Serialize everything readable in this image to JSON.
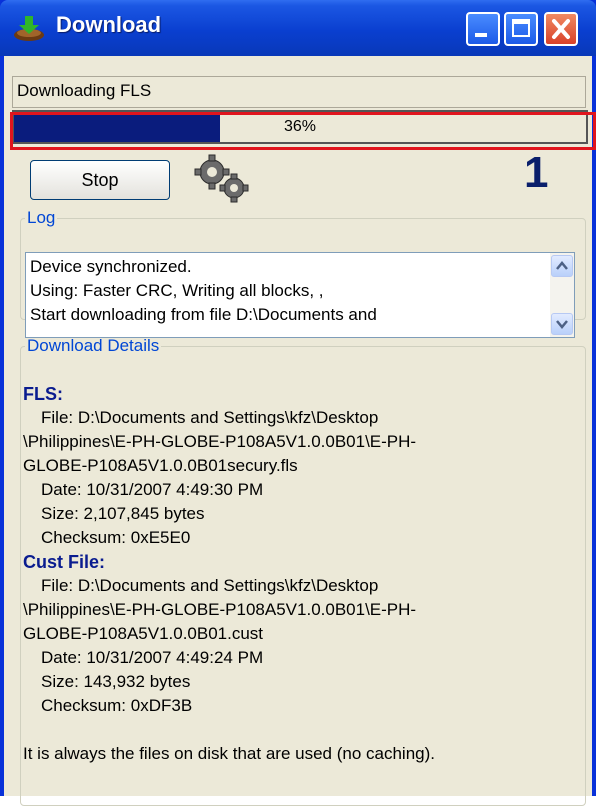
{
  "window": {
    "title": "Download"
  },
  "status_text": "Downloading FLS",
  "progress": {
    "percent": 36,
    "label": "36%"
  },
  "stop_label": "Stop",
  "step_number": "1",
  "log": {
    "legend": "Log",
    "lines": [
      "Device synchronized.",
      "Using: Faster CRC, Writing all blocks, ,",
      "Start downloading from file D:\\Documents and"
    ]
  },
  "details": {
    "legend": "Download Details",
    "fls": {
      "header": "FLS:",
      "file": "File: D:\\Documents and Settings\\kfz\\Desktop",
      "path1": "\\Philippines\\E-PH-GLOBE-P108A5V1.0.0B01\\E-PH-",
      "path2": "GLOBE-P108A5V1.0.0B01secury.fls",
      "date": "Date: 10/31/2007 4:49:30 PM",
      "size": "Size: 2,107,845 bytes",
      "checksum": "Checksum: 0xE5E0"
    },
    "cust": {
      "header": "Cust File:",
      "file": "File: D:\\Documents and Settings\\kfz\\Desktop",
      "path1": "\\Philippines\\E-PH-GLOBE-P108A5V1.0.0B01\\E-PH-",
      "path2": "GLOBE-P108A5V1.0.0B01.cust",
      "date": "Date: 10/31/2007 4:49:24 PM",
      "size": "Size: 143,932 bytes",
      "checksum": "Checksum: 0xDF3B"
    },
    "note": "It is always the files on disk that are used (no caching)."
  },
  "colors": {
    "title_bar": "#0a3fd0",
    "progress_fill": "#0a1c7d",
    "highlight": "#e0151d",
    "legend": "#0046d5",
    "section_header": "#0a1c8f"
  },
  "icons": [
    "download-app-icon",
    "minimize-icon",
    "maximize-icon",
    "close-icon",
    "gears-icon",
    "scroll-up-icon",
    "scroll-down-icon"
  ]
}
